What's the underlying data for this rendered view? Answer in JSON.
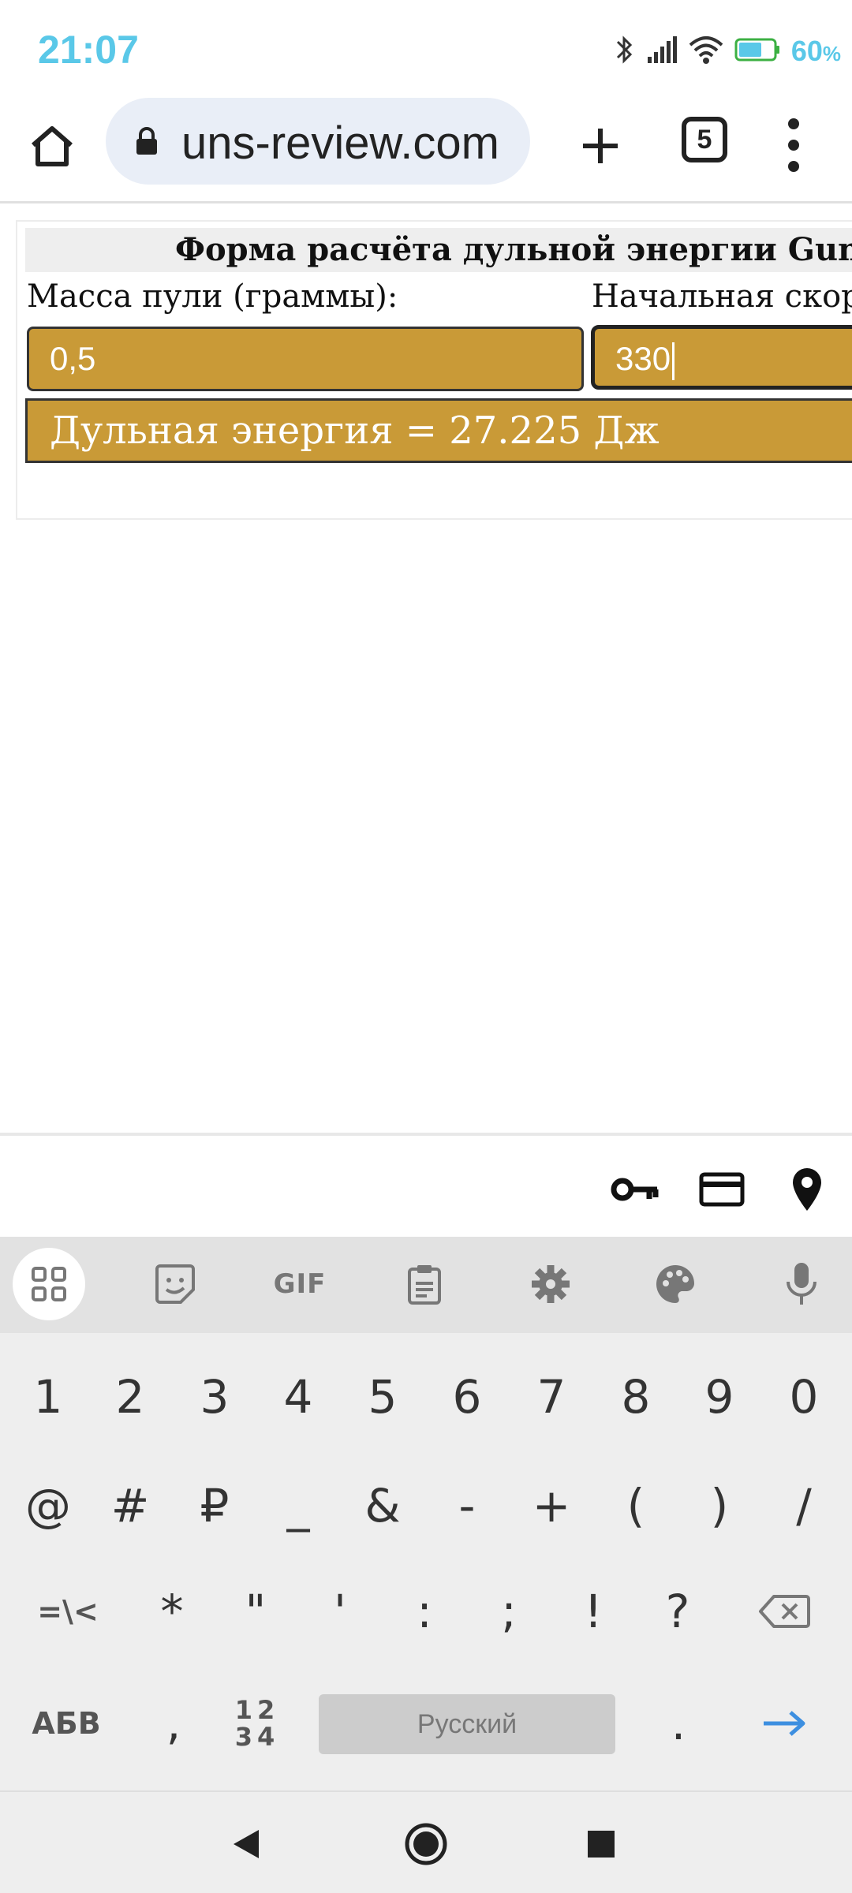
{
  "status_bar": {
    "time": "21:07",
    "battery_percent": "60",
    "battery_suffix": "%",
    "icons": [
      "bluetooth-icon",
      "signal-icon",
      "wifi-icon",
      "battery-icon"
    ]
  },
  "browser": {
    "url": "uns-review.com",
    "tab_count": "5",
    "icons": [
      "home-icon",
      "lock-icon",
      "new-tab-icon",
      "tabs-icon",
      "more-menu-icon"
    ]
  },
  "calculator": {
    "title": "Форма расчёта дульной энергии Guns",
    "mass_label": "Масса пули (граммы):",
    "mass_value": "0,5",
    "velocity_label": "Начальная скор",
    "velocity_value": "330",
    "result": "Дульная энергия = 27.225 Дж"
  },
  "colors": {
    "field_bg": "#c99a37",
    "status_accent": "#5ac8e8",
    "enter_arrow": "#3d8fe0"
  },
  "autofill": {
    "icons": [
      "password-key-icon",
      "credit-card-icon",
      "location-pin-icon"
    ]
  },
  "keyboard": {
    "toolbar": {
      "gif_label": "GIF",
      "icons": [
        "apps-grid-icon",
        "sticker-icon",
        "gif-icon",
        "clipboard-icon",
        "settings-icon",
        "theme-palette-icon",
        "microphone-icon"
      ]
    },
    "row1": [
      "1",
      "2",
      "3",
      "4",
      "5",
      "6",
      "7",
      "8",
      "9",
      "0"
    ],
    "row2": [
      "@",
      "#",
      "₽",
      "_",
      "&",
      "-",
      "+",
      "(",
      ")",
      "/"
    ],
    "row3": [
      "=\\<",
      "*",
      "\"",
      "'",
      ":",
      ";",
      "!",
      "?"
    ],
    "abc_label": "АБВ",
    "comma": ",",
    "num_top": "12",
    "num_bottom": "34",
    "space_label": "Русский",
    "period": "."
  },
  "navbar": {
    "icons": [
      "back-icon",
      "home-circle-icon",
      "recents-icon"
    ]
  }
}
